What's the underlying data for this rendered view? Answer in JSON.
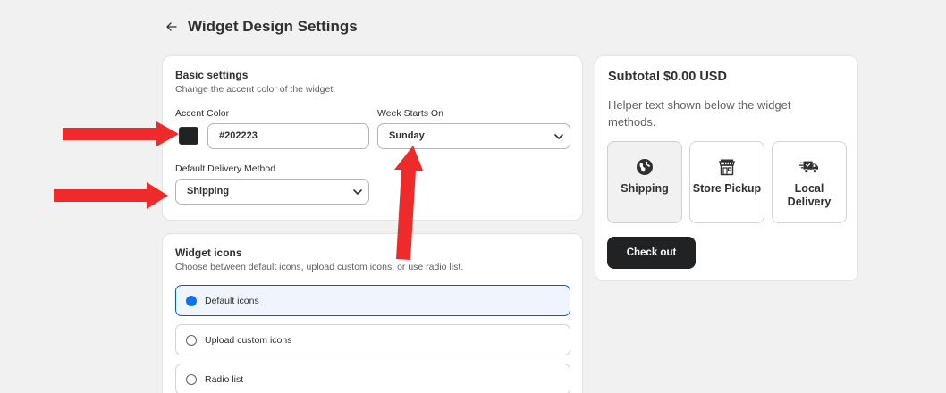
{
  "header": {
    "title": "Widget Design Settings"
  },
  "basic_settings": {
    "title": "Basic settings",
    "subtitle": "Change the accent color of the widget.",
    "accent_color_label": "Accent Color",
    "accent_color_value": "#202223",
    "week_starts_label": "Week Starts On",
    "week_starts_value": "Sunday",
    "delivery_method_label": "Default Delivery Method",
    "delivery_method_value": "Shipping"
  },
  "widget_icons": {
    "title": "Widget icons",
    "subtitle": "Choose between default icons, upload custom icons, or use radio list.",
    "options": [
      {
        "label": "Default icons",
        "selected": true
      },
      {
        "label": "Upload custom icons",
        "selected": false
      },
      {
        "label": "Radio list",
        "selected": false
      }
    ]
  },
  "preview": {
    "subtotal": "Subtotal $0.00 USD",
    "helper_text": "Helper text shown below the widget methods.",
    "methods": [
      {
        "label": "Shipping",
        "icon": "globe-icon",
        "active": true
      },
      {
        "label": "Store Pickup",
        "icon": "storefront-icon",
        "active": false
      },
      {
        "label": "Local Delivery",
        "icon": "delivery-truck-icon",
        "active": false
      }
    ],
    "checkout_label": "Check out"
  },
  "colors": {
    "accent": "#202223",
    "selection_blue": "#005bd3",
    "annotation_red": "#ee2a2a"
  }
}
